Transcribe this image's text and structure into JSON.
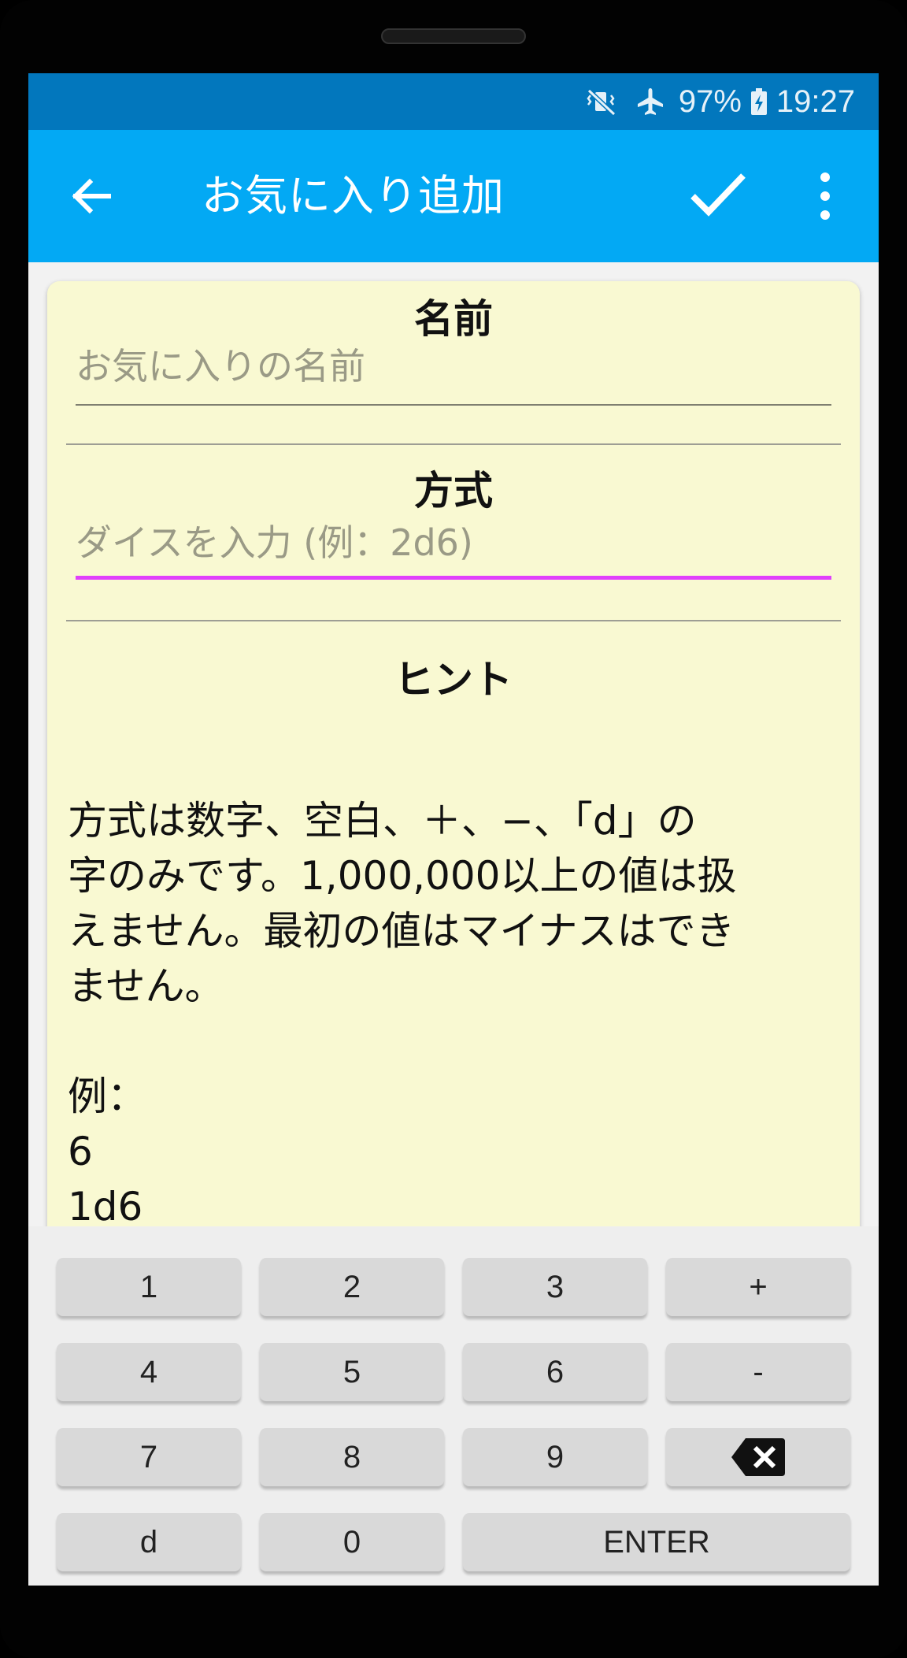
{
  "status_bar": {
    "icons": [
      "vibrate-mute-icon",
      "airplane-mode-icon",
      "battery-charging-icon"
    ],
    "battery": "97%",
    "time": "19:27"
  },
  "app_bar": {
    "title": "お気に入り追加",
    "icons": [
      "back-arrow-icon",
      "check-icon",
      "more-vert-icon"
    ],
    "color": "#03a9f4",
    "status_color": "#0277bd"
  },
  "form": {
    "name": {
      "label": "名前",
      "placeholder": "お気に入りの名前",
      "value": ""
    },
    "formula": {
      "label": "方式",
      "placeholder": "ダイスを入力 (例：2d6)",
      "value": "",
      "focus_color": "#e040fb"
    },
    "hint": {
      "label": "ヒント",
      "body": "方式は数字、空白、＋、−、「d」の\n字のみです。1,000,000以上の値は扱\nえません。最初の値はマイナスはでき\nません。\n\n例：\n6\n1d6"
    },
    "card_color": "#f9f9d2"
  },
  "keyboard": {
    "keys": [
      "1",
      "2",
      "3",
      "+",
      "4",
      "5",
      "6",
      "-",
      "7",
      "8",
      "9",
      "backspace",
      "d",
      "0",
      "ENTER"
    ],
    "backspace_icon": "backspace-icon"
  }
}
